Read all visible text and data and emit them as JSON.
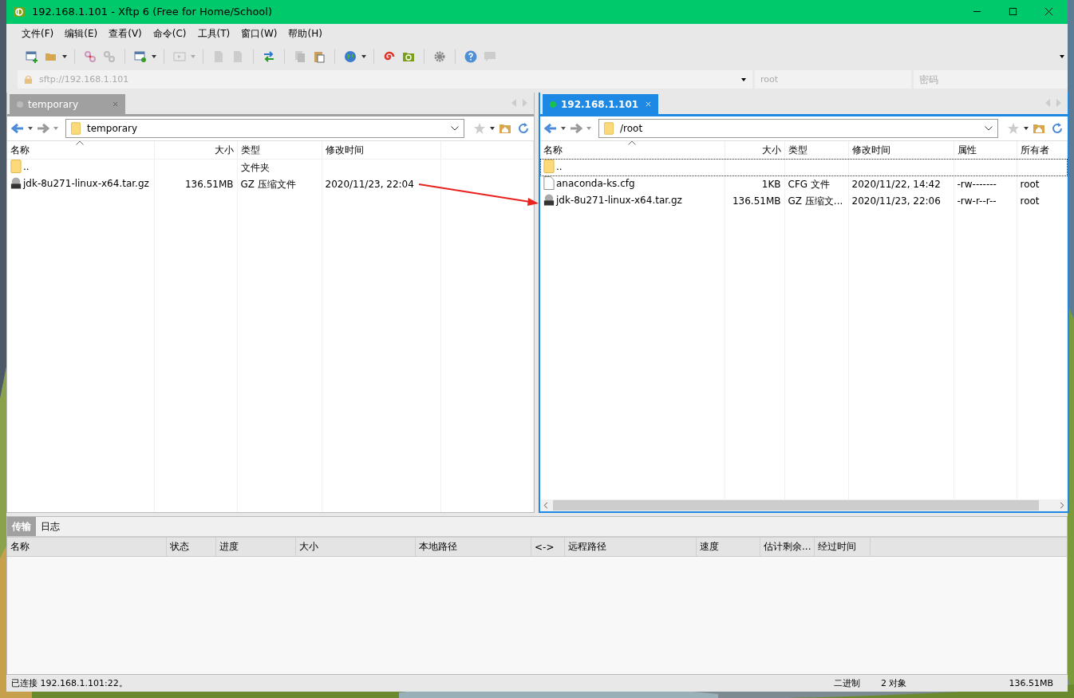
{
  "window": {
    "title": "192.168.1.101 - Xftp 6 (Free for Home/School)"
  },
  "menu": [
    "文件(F)",
    "编辑(E)",
    "查看(V)",
    "命令(C)",
    "工具(T)",
    "窗口(W)",
    "帮助(H)"
  ],
  "address": {
    "url_placeholder": "sftp://192.168.1.101",
    "user_placeholder": "root",
    "password_placeholder": "密码"
  },
  "panels": [
    {
      "tab": {
        "label": "temporary",
        "connected": false,
        "selected": false
      },
      "path": "temporary",
      "columns": [
        "名称",
        "大小",
        "类型",
        "修改时间"
      ],
      "rows": [
        {
          "kind": "folder",
          "name": "..",
          "type": "文件夹",
          "focused": false
        },
        {
          "kind": "archive",
          "name": "jdk-8u271-linux-x64.tar.gz",
          "size": "136.51MB",
          "type": "GZ 压缩文件",
          "modified": "2020/11/23, 22:04",
          "focused": false
        }
      ]
    },
    {
      "tab": {
        "label": "192.168.1.101",
        "connected": true,
        "selected": true
      },
      "path": "/root",
      "columns": [
        "名称",
        "大小",
        "类型",
        "修改时间",
        "属性",
        "所有者"
      ],
      "rows": [
        {
          "kind": "folder",
          "name": "..",
          "focused": true
        },
        {
          "kind": "file",
          "name": "anaconda-ks.cfg",
          "size": "1KB",
          "type": "CFG 文件",
          "modified": "2020/11/22, 14:42",
          "permissions": "-rw-------",
          "owner": "root",
          "focused": false
        },
        {
          "kind": "archive",
          "name": "jdk-8u271-linux-x64.tar.gz",
          "size": "136.51MB",
          "type": "GZ 压缩文...",
          "modified": "2020/11/23, 22:06",
          "permissions": "-rw-r--r--",
          "owner": "root",
          "focused": false
        }
      ]
    }
  ],
  "bottom_tabs": [
    {
      "label": "传输",
      "selected": true
    },
    {
      "label": "日志",
      "selected": false
    }
  ],
  "transfer_columns": [
    "名称",
    "状态",
    "进度",
    "大小",
    "本地路径",
    "<->",
    "远程路径",
    "速度",
    "估计剩余...",
    "经过时间"
  ],
  "status_bar": {
    "message": "已连接 192.168.1.101:22。",
    "mode": "二进制",
    "objects": "2 对象",
    "size": "136.51MB"
  }
}
